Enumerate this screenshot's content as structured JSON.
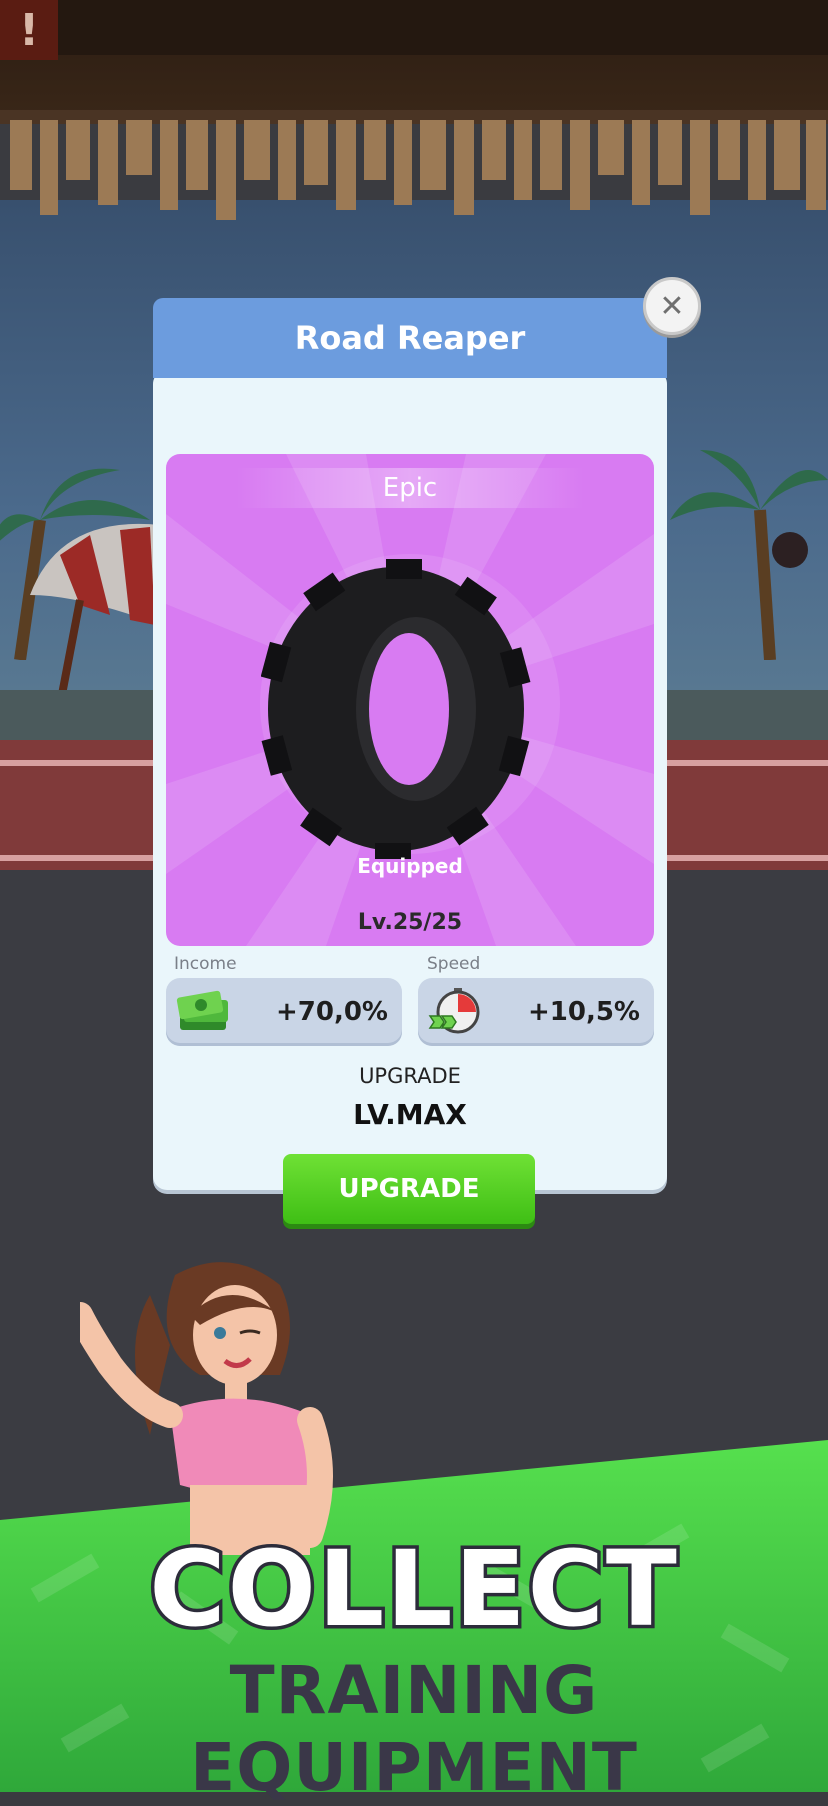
{
  "dialog": {
    "title": "Road Reaper",
    "close_icon": "close-x-icon",
    "rarity": "Epic",
    "status": "Equipped",
    "level": "Lv.25/25",
    "card_color": "#d87bf2",
    "stats": [
      {
        "label": "Income",
        "value": "+70,0%",
        "icon": "money-stack-icon"
      },
      {
        "label": "Speed",
        "value": "+10,5%",
        "icon": "stopwatch-speed-icon"
      }
    ],
    "upgrade_title": "UPGRADE",
    "upgrade_level": "LV.MAX",
    "upgrade_button": "UPGRADE",
    "button_color": "#4fcf20"
  },
  "banner": {
    "headline": "COLLECT",
    "subline": "TRAINING EQUIPMENT",
    "banner_color": "#4bd24a"
  }
}
